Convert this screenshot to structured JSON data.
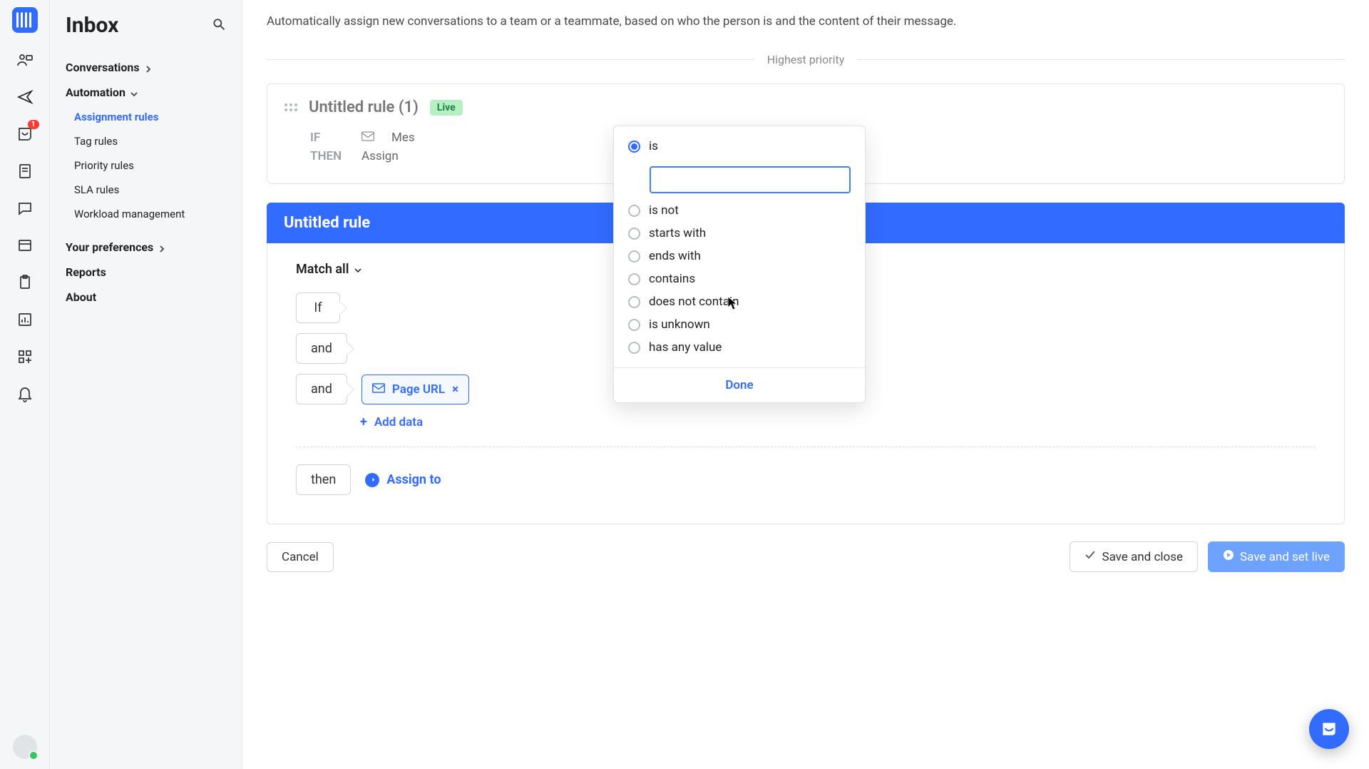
{
  "rail": {
    "badge_count": "1"
  },
  "sidebar": {
    "title": "Inbox",
    "nav": {
      "conversations": "Conversations",
      "automation": "Automation",
      "assignment_rules": "Assignment rules",
      "tag_rules": "Tag rules",
      "priority_rules": "Priority rules",
      "sla_rules": "SLA rules",
      "workload": "Workload management",
      "your_prefs": "Your preferences",
      "reports": "Reports",
      "about": "About"
    }
  },
  "main": {
    "description": "Automatically assign new conversations to a team or a teammate, based on who the person is and the content of their message.",
    "divider": "Highest priority",
    "rule_card": {
      "title": "Untitled rule (1)",
      "badge": "Live",
      "if_kw": "IF",
      "if_text": "Mes",
      "then_kw": "THEN",
      "then_text": "Assign"
    },
    "editor": {
      "header": "Untitled rule",
      "match_label": "Match all",
      "rows": {
        "if": "If",
        "and1": "and",
        "and2": "and",
        "then": "then"
      },
      "chip_label": "Page URL",
      "add_data": "Add data",
      "assign_to": "Assign to"
    },
    "footer": {
      "cancel": "Cancel",
      "save_close": "Save and close",
      "save_live": "Save and set live"
    }
  },
  "popover": {
    "options": {
      "is": "is",
      "is_not": "is not",
      "starts_with": "starts with",
      "ends_with": "ends with",
      "contains": "contains",
      "not_contain": "does not contain",
      "unknown": "is unknown",
      "any_value": "has any value"
    },
    "done": "Done",
    "input_value": ""
  }
}
